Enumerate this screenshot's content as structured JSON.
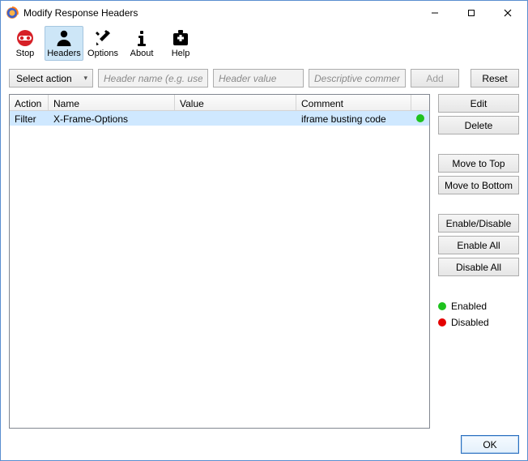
{
  "window": {
    "title": "Modify Response Headers"
  },
  "toolbar": {
    "stop": "Stop",
    "headers": "Headers",
    "options": "Options",
    "about": "About",
    "help": "Help"
  },
  "form": {
    "select_action": "Select action",
    "name_placeholder": "Header name (e.g. user-agent)",
    "value_placeholder": "Header value",
    "comment_placeholder": "Descriptive comment",
    "add": "Add",
    "reset": "Reset"
  },
  "table": {
    "headers": {
      "action": "Action",
      "name": "Name",
      "value": "Value",
      "comment": "Comment"
    },
    "rows": [
      {
        "action": "Filter",
        "name": "X-Frame-Options",
        "value": "",
        "comment": "iframe busting code",
        "status": "enabled"
      }
    ]
  },
  "side": {
    "edit": "Edit",
    "delete": "Delete",
    "move_top": "Move to Top",
    "move_bottom": "Move to Bottom",
    "enable_disable": "Enable/Disable",
    "enable_all": "Enable All",
    "disable_all": "Disable All",
    "legend_enabled": "Enabled",
    "legend_disabled": "Disabled"
  },
  "footer": {
    "ok": "OK"
  },
  "colors": {
    "enabled": "#1ec21e",
    "disabled": "#e40000"
  }
}
